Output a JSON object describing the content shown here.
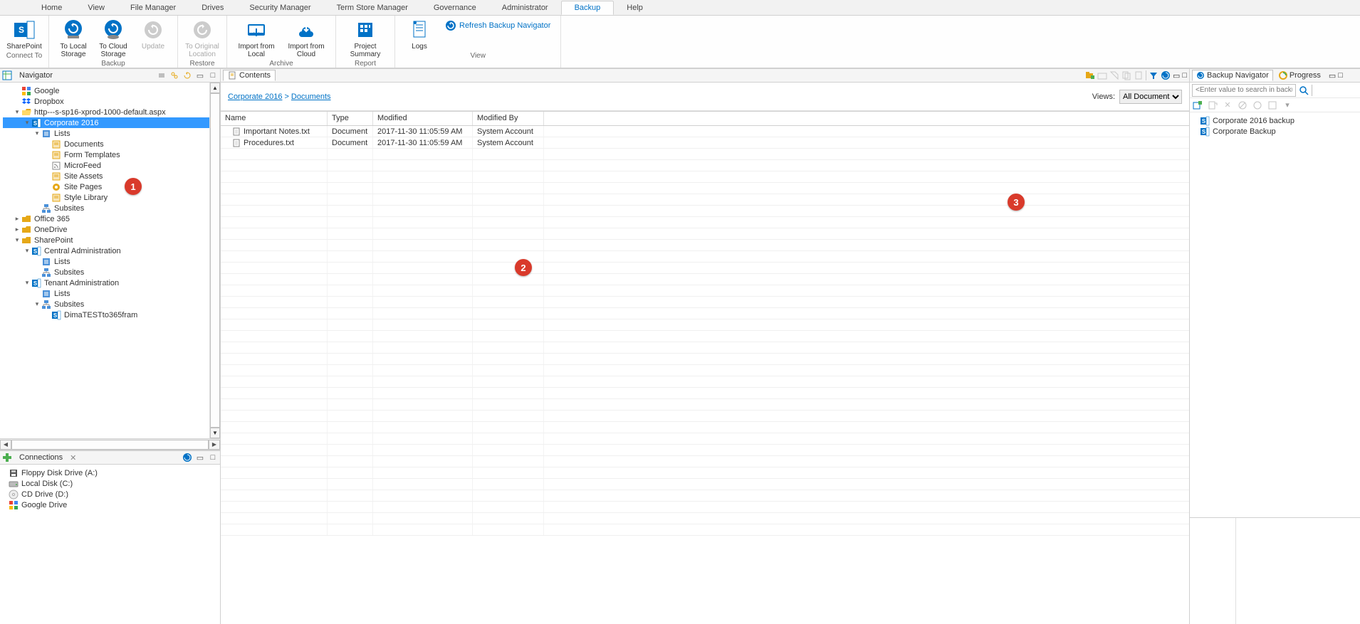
{
  "menubar": {
    "tabs": [
      "Home",
      "View",
      "File Manager",
      "Drives",
      "Security Manager",
      "Term Store Manager",
      "Governance",
      "Administrator",
      "Backup",
      "Help"
    ],
    "active": "Backup"
  },
  "ribbon": {
    "groups": [
      {
        "label": "Connect To",
        "buttons": [
          {
            "id": "sharepoint",
            "label": "SharePoint"
          }
        ]
      },
      {
        "label": "Backup",
        "buttons": [
          {
            "id": "to-local",
            "label": "To Local Storage"
          },
          {
            "id": "to-cloud",
            "label": "To Cloud Storage"
          },
          {
            "id": "update",
            "label": "Update",
            "disabled": true
          }
        ]
      },
      {
        "label": "Restore",
        "buttons": [
          {
            "id": "orig",
            "label": "To Original Location",
            "disabled": true
          }
        ]
      },
      {
        "label": "Archive",
        "buttons": [
          {
            "id": "imp-local",
            "label": "Import from Local"
          },
          {
            "id": "imp-cloud",
            "label": "Import from Cloud"
          }
        ]
      },
      {
        "label": "Report",
        "buttons": [
          {
            "id": "proj-summary",
            "label": "Project Summary"
          }
        ]
      },
      {
        "label": "View",
        "buttons": [
          {
            "id": "logs",
            "label": "Logs"
          }
        ],
        "link": {
          "id": "refresh-backup",
          "label": "Refresh Backup Navigator"
        }
      }
    ]
  },
  "navigator": {
    "title": "Navigator",
    "nodes": [
      {
        "indent": 1,
        "icon": "google",
        "label": "Google"
      },
      {
        "indent": 1,
        "icon": "dropbox",
        "label": "Dropbox"
      },
      {
        "indent": 1,
        "icon": "folder-open",
        "label": "http---s-sp16-xprod-1000-default.aspx",
        "exp": "-"
      },
      {
        "indent": 2,
        "icon": "sp",
        "label": "Corporate 2016",
        "exp": "-",
        "selected": true
      },
      {
        "indent": 3,
        "icon": "lists",
        "label": "Lists",
        "exp": "-"
      },
      {
        "indent": 4,
        "icon": "doclib",
        "label": "Documents"
      },
      {
        "indent": 4,
        "icon": "doclib",
        "label": "Form Templates"
      },
      {
        "indent": 4,
        "icon": "feed",
        "label": "MicroFeed"
      },
      {
        "indent": 4,
        "icon": "doclib",
        "label": "Site Assets"
      },
      {
        "indent": 4,
        "icon": "pages",
        "label": "Site Pages"
      },
      {
        "indent": 4,
        "icon": "doclib",
        "label": "Style Library"
      },
      {
        "indent": 3,
        "icon": "subsites",
        "label": "Subsites"
      },
      {
        "indent": 1,
        "icon": "folder",
        "label": "Office 365",
        "exp": "+"
      },
      {
        "indent": 1,
        "icon": "folder",
        "label": "OneDrive",
        "exp": "+"
      },
      {
        "indent": 1,
        "icon": "folder",
        "label": "SharePoint",
        "exp": "-"
      },
      {
        "indent": 2,
        "icon": "sp",
        "label": "Central Administration",
        "exp": "-"
      },
      {
        "indent": 3,
        "icon": "lists",
        "label": "Lists"
      },
      {
        "indent": 3,
        "icon": "subsites",
        "label": "Subsites"
      },
      {
        "indent": 2,
        "icon": "sp",
        "label": "Tenant Administration",
        "exp": "-"
      },
      {
        "indent": 3,
        "icon": "lists",
        "label": "Lists"
      },
      {
        "indent": 3,
        "icon": "subsites",
        "label": "Subsites",
        "exp": "-"
      },
      {
        "indent": 4,
        "icon": "sp",
        "label": "DimaTESTto365fram"
      }
    ]
  },
  "connections": {
    "title": "Connections",
    "items": [
      {
        "icon": "floppy",
        "label": "Floppy Disk Drive (A:)"
      },
      {
        "icon": "disk",
        "label": "Local Disk (C:)"
      },
      {
        "icon": "cd",
        "label": "CD Drive (D:)"
      },
      {
        "icon": "google",
        "label": "Google Drive"
      }
    ]
  },
  "contents": {
    "title": "Contents",
    "breadcrumb": [
      "Corporate 2016",
      "Documents"
    ],
    "views_label": "Views:",
    "views_value": "All Documents",
    "columns": [
      "Name",
      "Type",
      "Modified",
      "Modified By"
    ],
    "rows": [
      {
        "name": "Important Notes.txt",
        "type": "Document",
        "modified": "2017-11-30 11:05:59 AM",
        "modifiedby": "System Account"
      },
      {
        "name": "Procedures.txt",
        "type": "Document",
        "modified": "2017-11-30 11:05:59 AM",
        "modifiedby": "System Account"
      }
    ]
  },
  "backup_nav": {
    "title": "Backup Navigator",
    "progress_tab": "Progress",
    "search_placeholder": "<Enter value to search in backup>",
    "items": [
      {
        "icon": "sp",
        "label": "Corporate 2016 backup"
      },
      {
        "icon": "sp",
        "label": "Corporate Backup"
      }
    ]
  },
  "callouts": {
    "1": "1",
    "2": "2",
    "3": "3"
  }
}
